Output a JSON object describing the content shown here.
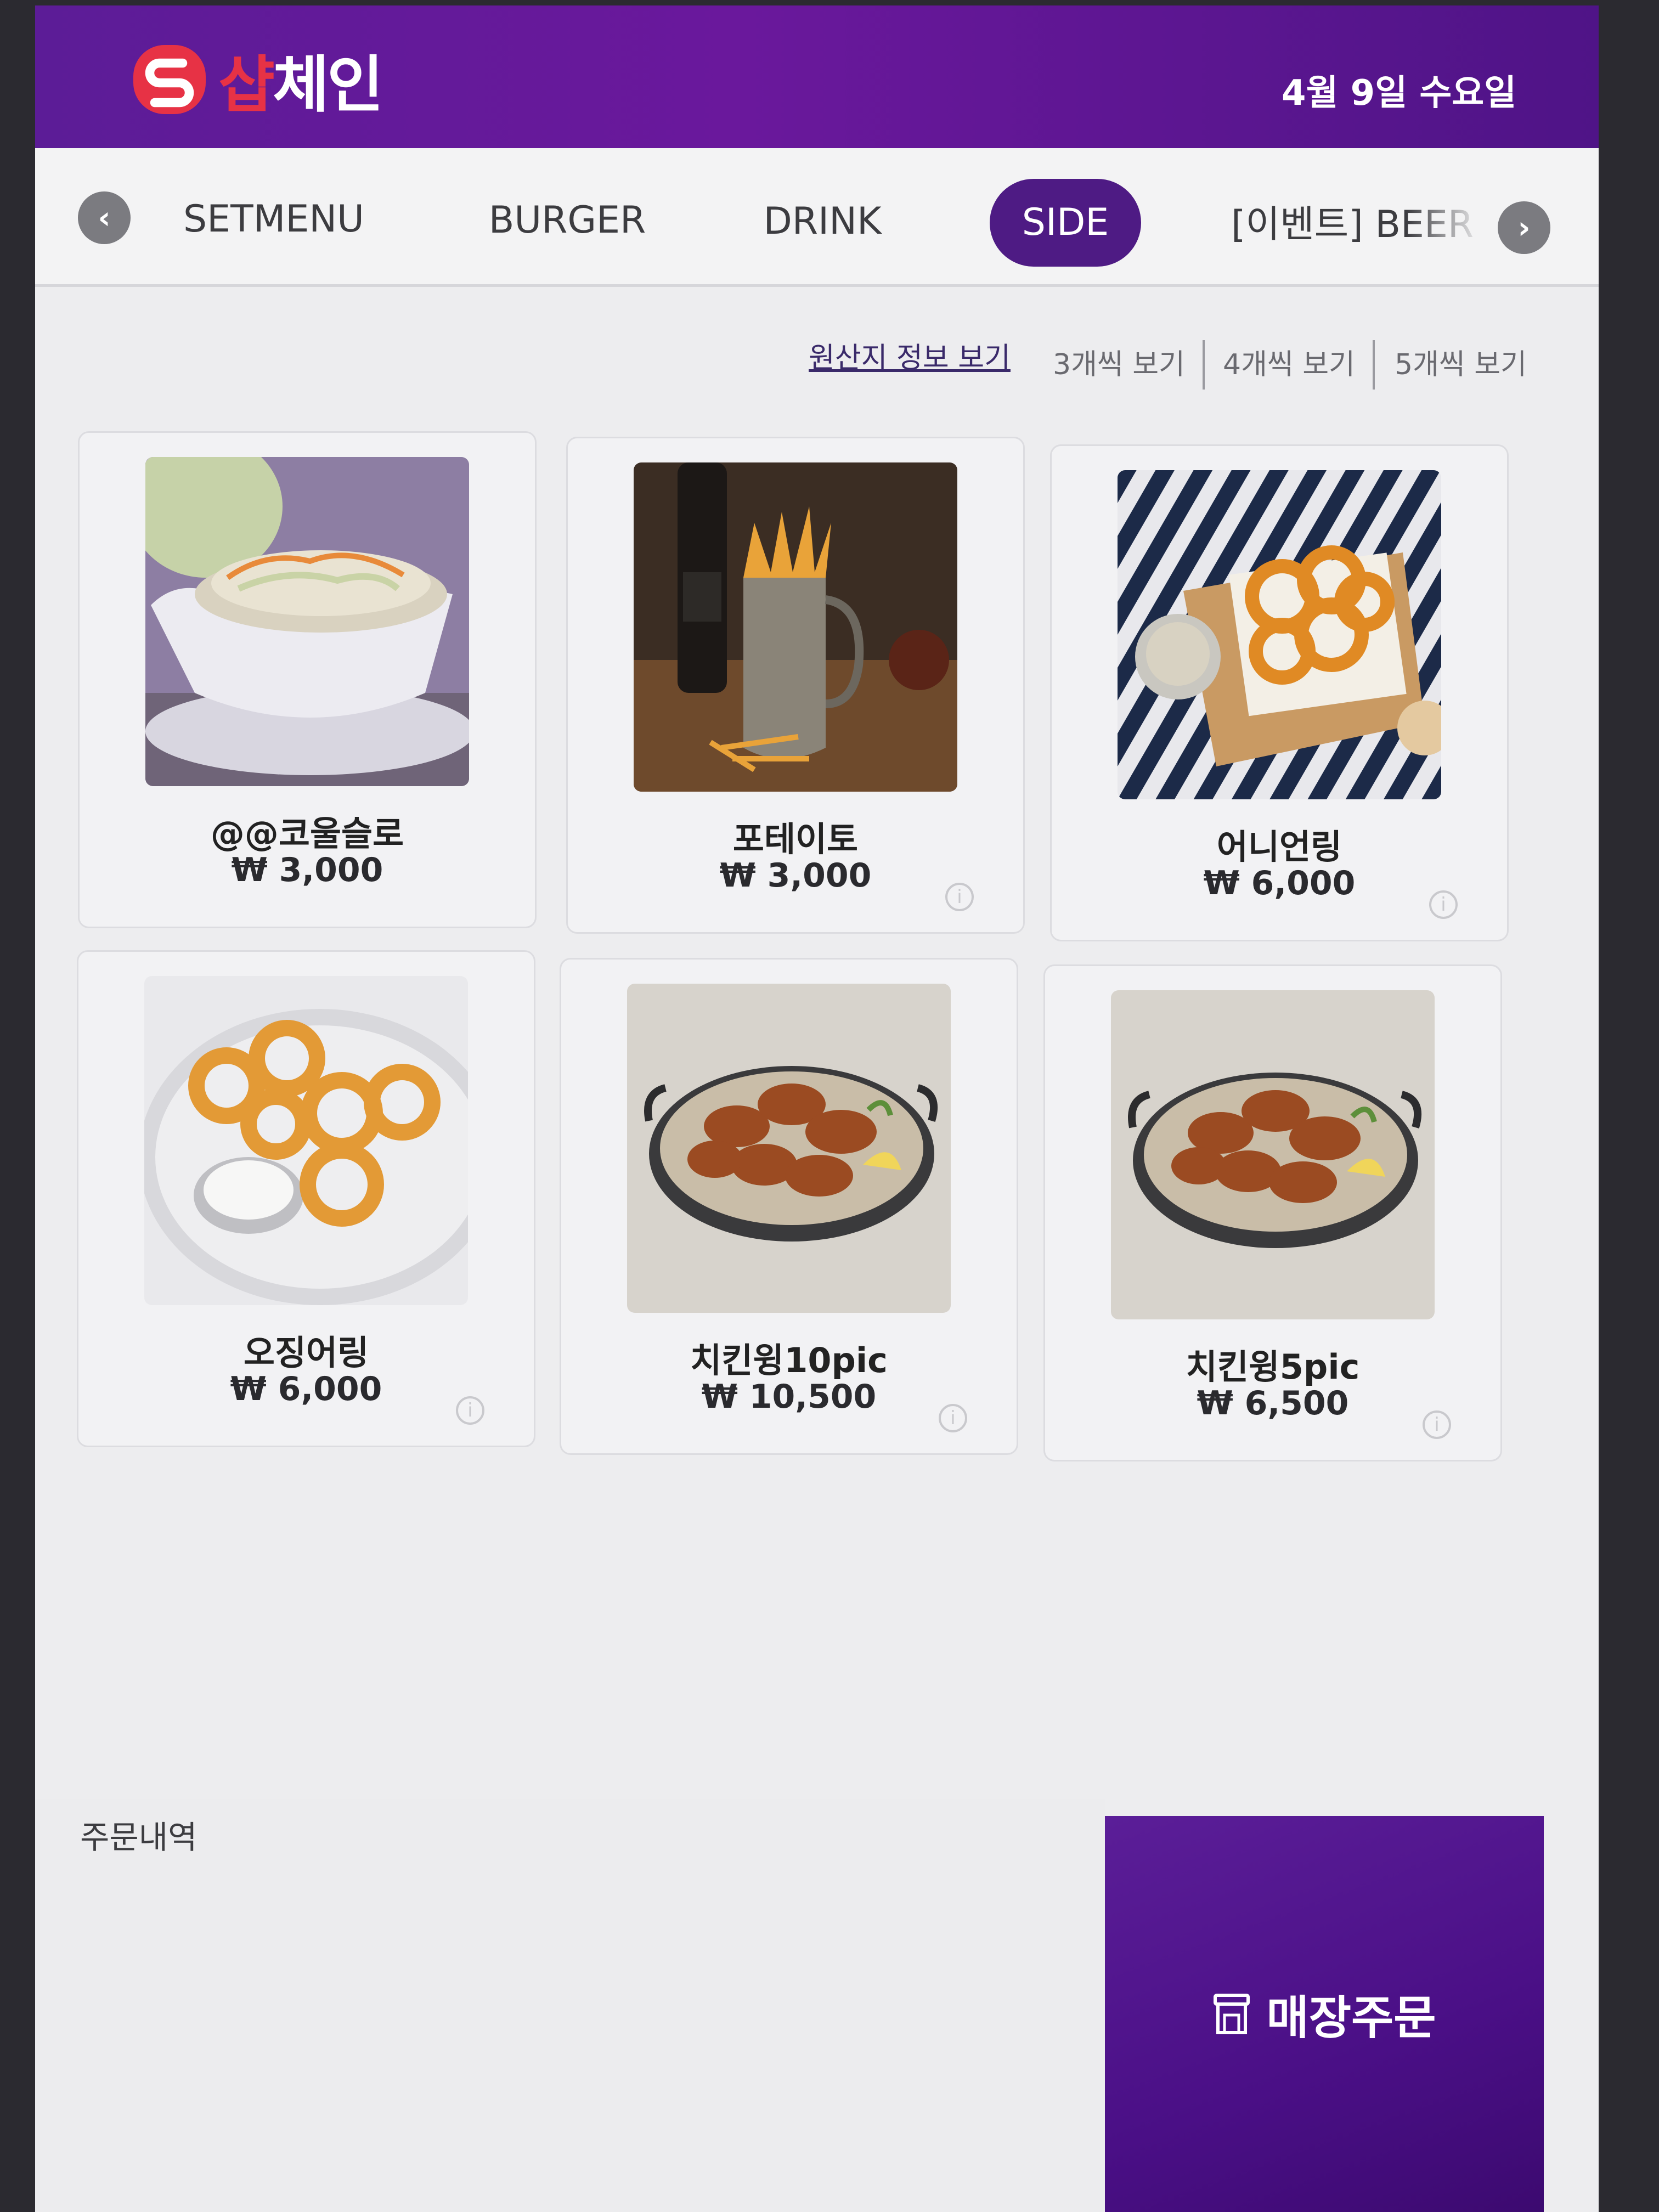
{
  "header": {
    "logo_text_red": "샵",
    "logo_text_white": "체인",
    "date": "4월 9일 수요일"
  },
  "tabs": {
    "prev_icon": "chevron-left-icon",
    "next_icon": "chevron-right-icon",
    "items": [
      {
        "label": "SETMENU",
        "active": false
      },
      {
        "label": "BURGER",
        "active": false
      },
      {
        "label": "DRINK",
        "active": false
      },
      {
        "label": "SIDE",
        "active": true
      },
      {
        "label": "[이벤트] BEER",
        "active": false
      }
    ]
  },
  "view_options": {
    "origin_info": "원산지 정보 보기",
    "options": [
      "3개씩 보기",
      "4개씩 보기",
      "5개씩 보기"
    ]
  },
  "products": [
    {
      "name": "@@코울슬로",
      "price": "₩ 3,000",
      "info_icon": false
    },
    {
      "name": "포테이토",
      "price": "₩ 3,000",
      "info_icon": true
    },
    {
      "name": "어니언링",
      "price": "₩ 6,000",
      "info_icon": true
    },
    {
      "name": "오징어링",
      "price": "₩ 6,000",
      "info_icon": true
    },
    {
      "name": "치킨윙10pic",
      "price": "₩ 10,500",
      "info_icon": true
    },
    {
      "name": "치킨윙5pic",
      "price": "₩ 6,500",
      "info_icon": true
    }
  ],
  "order": {
    "title": "주문내역",
    "store_order_label": "매장주문"
  },
  "colors": {
    "brand_purple": "#5c1c97",
    "active_tab": "#4e1b84",
    "logo_red": "#e73245"
  }
}
